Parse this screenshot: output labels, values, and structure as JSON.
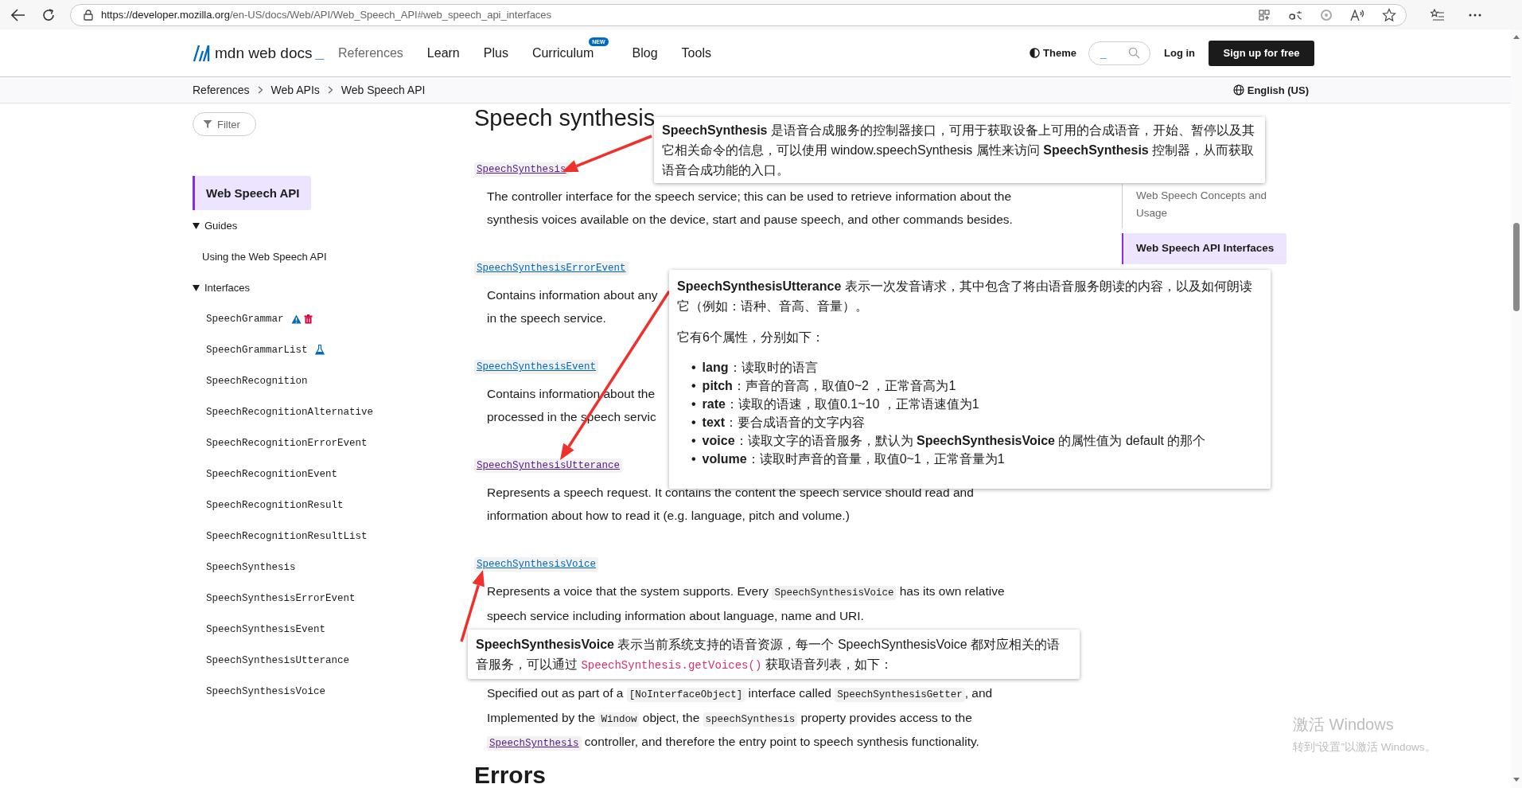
{
  "browser": {
    "url_host": "https://developer.mozilla.org",
    "url_path": "/en-US/docs/Web/API/Web_Speech_API#web_speech_api_interfaces"
  },
  "header": {
    "logo_text": "mdn web docs",
    "logo_cursor": "_",
    "nav": [
      {
        "label": "References",
        "selected": true
      },
      {
        "label": "Learn",
        "selected": false
      },
      {
        "label": "Plus",
        "selected": false
      },
      {
        "label": "Curriculum",
        "selected": false,
        "badge": "NEW"
      },
      {
        "label": "Blog",
        "selected": false
      },
      {
        "label": "Tools",
        "selected": false
      }
    ],
    "theme": "Theme",
    "search": {
      "hint": "_"
    },
    "login": "Log in",
    "signup": "Sign up for free"
  },
  "breadcrumbs": [
    "References",
    "Web APIs",
    "Web Speech API"
  ],
  "language": "English (US)",
  "sidebar": {
    "filter": {
      "placeholder": "Filter"
    },
    "title": {
      "label": "Web Speech API",
      "selected": true
    },
    "sections": [
      {
        "label": "Guides",
        "kind": "guide",
        "expanded": true,
        "children": [
          {
            "label": "Using the Web Speech API"
          }
        ]
      },
      {
        "label": "Interfaces",
        "kind": "interface",
        "expanded": true,
        "children": [
          {
            "label": "SpeechGrammar",
            "badges": [
              {
                "kind": "warning"
              },
              {
                "kind": "deprecated"
              }
            ]
          },
          {
            "label": "SpeechGrammarList",
            "badges": [
              {
                "kind": "experimental"
              }
            ]
          },
          {
            "label": "SpeechRecognition"
          },
          {
            "label": "SpeechRecognitionAlternative"
          },
          {
            "label": "SpeechRecognitionErrorEvent"
          },
          {
            "label": "SpeechRecognitionEvent"
          },
          {
            "label": "SpeechRecognitionResult"
          },
          {
            "label": "SpeechRecognitionResultList"
          },
          {
            "label": "SpeechSynthesis"
          },
          {
            "label": "SpeechSynthesisErrorEvent"
          },
          {
            "label": "SpeechSynthesisEvent"
          },
          {
            "label": "SpeechSynthesisUtterance"
          },
          {
            "label": "SpeechSynthesisVoice"
          }
        ]
      }
    ]
  },
  "main": {
    "heading": "Speech synthesis",
    "entries": [
      {
        "name": "SpeechSynthesis",
        "visited": true,
        "paragraphs": [
          {
            "lines": [
              [
                {
                  "kind": "text",
                  "text": "The controller interface for the speech service; this can be used to retrieve information about the"
                }
              ],
              [
                {
                  "kind": "text",
                  "text": "synthesis voices available on the device, start and pause speech, and other commands besides."
                }
              ]
            ]
          }
        ]
      },
      {
        "name": "SpeechSynthesisErrorEvent",
        "visited": false,
        "paragraphs": [
          {
            "lines": [
              [
                {
                  "kind": "text",
                  "text": "Contains information about any"
                }
              ],
              [
                {
                  "kind": "text",
                  "text": "in the speech service."
                }
              ]
            ]
          }
        ]
      },
      {
        "name": "SpeechSynthesisEvent",
        "visited": false,
        "paragraphs": [
          {
            "lines": [
              [
                {
                  "kind": "text",
                  "text": "Contains information about the"
                }
              ],
              [
                {
                  "kind": "text",
                  "text": "processed in the speech servic"
                }
              ]
            ]
          }
        ]
      },
      {
        "name": "SpeechSynthesisUtterance",
        "visited": true,
        "paragraphs": [
          {
            "lines": [
              [
                {
                  "kind": "text",
                  "text": "Represents a speech request. It contains the content the speech service should read and"
                }
              ],
              [
                {
                  "kind": "text",
                  "text": "information about how to read it (e.g. language, pitch and volume.)"
                }
              ]
            ]
          }
        ]
      },
      {
        "name": "SpeechSynthesisVoice",
        "visited": false,
        "paragraphs": [
          {
            "lines": [
              [
                {
                  "kind": "text",
                  "text": "Represents a voice that the system supports. Every "
                },
                {
                  "kind": "code",
                  "text": "SpeechSynthesisVoice"
                },
                {
                  "kind": "text",
                  "text": " has its own relative"
                }
              ],
              [
                {
                  "kind": "text",
                  "text": "speech service including information about language, name and URI."
                }
              ]
            ]
          },
          {
            "lines": [
              [
                {
                  "kind": "text",
                  "text": "Specified out as part of a "
                },
                {
                  "kind": "code",
                  "text": "[NoInterfaceObject]"
                },
                {
                  "kind": "text",
                  "text": " interface called "
                },
                {
                  "kind": "code",
                  "text": "SpeechSynthesisGetter"
                },
                {
                  "kind": "text",
                  "text": ", and"
                }
              ],
              [
                {
                  "kind": "text",
                  "text": "Implemented by the "
                },
                {
                  "kind": "code",
                  "text": "Window"
                },
                {
                  "kind": "text",
                  "text": " object, the "
                },
                {
                  "kind": "code",
                  "text": "speechSynthesis"
                },
                {
                  "kind": "text",
                  "text": " property provides access to the"
                }
              ],
              [
                {
                  "kind": "link",
                  "text": "SpeechSynthesis"
                },
                {
                  "kind": "text",
                  "text": " controller, and therefore the entry point to speech synthesis functionality."
                }
              ]
            ]
          }
        ]
      }
    ],
    "next_heading": "Errors"
  },
  "toc": [
    {
      "label": "Web Speech Concepts and Usage",
      "selected": false
    },
    {
      "label": "Web Speech API Interfaces",
      "selected": true
    }
  ],
  "callouts": [
    {
      "paragraphs": [
        [
          {
            "kind": "rich",
            "text": "**SpeechSynthesis** 是语音合成服务的控制器接口，可用于获取设备上可用的合成语音，开始、暂停以及其它相关命令的信息，可以使用 window.speechSynthesis 属性来访问 **SpeechSynthesis** 控制器，从而获取语音合成功能的入口。"
          }
        ]
      ]
    },
    {
      "paragraphs": [
        [
          {
            "kind": "rich",
            "text": "**SpeechSynthesisUtterance** 表示一次发音请求，其中包含了将由语音服务朗读的内容，以及如何朗读它（例如：语种、音高、音量）。"
          }
        ],
        [
          {
            "kind": "rich",
            "text": "它有6个属性，分别如下："
          }
        ]
      ],
      "list": [
        {
          "marker": "•",
          "text": "**lang**：读取时的语言"
        },
        {
          "marker": "•",
          "text": "**pitch**：声音的音高，取值0~2 ，正常音高为1"
        },
        {
          "marker": "•",
          "text": "**rate**：读取的语速，取值0.1~10 ，正常语速值为1"
        },
        {
          "marker": "•",
          "text": "**text**：要合成语音的文字内容"
        },
        {
          "marker": "•",
          "text": "**voice**：读取文字的语音服务，默认为 **SpeechSynthesisVoice** 的属性值为 default 的那个"
        },
        {
          "marker": "•",
          "text": "**volume**：读取时声音的音量，取值0~1，正常音量为1"
        }
      ]
    },
    {
      "paragraphs": [
        [
          {
            "kind": "rich",
            "text": "**SpeechSynthesisVoice** 表示当前系统支持的语音资源，每一个 SpeechSynthesisVoice 都对应相关的语音服务，可以通过 "
          },
          {
            "kind": "code",
            "text": "SpeechSynthesis.getVoices()"
          },
          {
            "kind": "rich",
            "text": " 获取语音列表，如下："
          }
        ]
      ]
    }
  ],
  "os_notice": {
    "title": "激活 Windows",
    "text": "转到“设置”以激活 Windows。"
  }
}
